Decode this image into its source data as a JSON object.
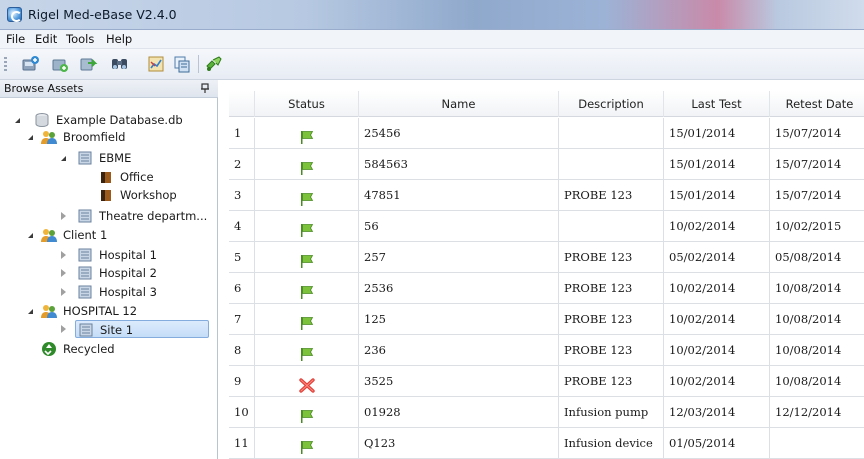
{
  "window": {
    "title": "Rigel Med-eBase V2.4.0"
  },
  "menu": [
    "File",
    "Edit",
    "Tools",
    "Help"
  ],
  "toolbar": {
    "buttons": [
      "add-asset-icon",
      "add-site-icon",
      "export-icon",
      "find-icon",
      "chart-icon",
      "copy-icon",
      "sync-icon"
    ]
  },
  "browse_panel": {
    "title": "Browse Assets"
  },
  "tree": {
    "database": "Example Database.db",
    "broomfield": "Broomfield",
    "ebme": "EBME",
    "office": "Office",
    "workshop": "Workshop",
    "theatre": "Theatre departm...",
    "client1": "Client 1",
    "hospital1": "Hospital 1",
    "hospital2": "Hospital 2",
    "hospital3": "Hospital 3",
    "hospital12": "HOSPITAL 12",
    "site1": "Site 1",
    "recycled": "Recycled"
  },
  "grid": {
    "columns": [
      "",
      "Status",
      "Name",
      "Description",
      "Last Test",
      "Retest Date"
    ],
    "rows": [
      {
        "num": "1",
        "status": "pass",
        "name": "25456",
        "description": "",
        "last_test": "15/01/2014",
        "retest": "15/07/2014"
      },
      {
        "num": "2",
        "status": "pass",
        "name": "584563",
        "description": "",
        "last_test": "15/01/2014",
        "retest": "15/07/2014"
      },
      {
        "num": "3",
        "status": "pass",
        "name": "47851",
        "description": "PROBE 123",
        "last_test": "15/01/2014",
        "retest": "15/07/2014"
      },
      {
        "num": "4",
        "status": "pass",
        "name": "56",
        "description": "",
        "last_test": "10/02/2014",
        "retest": "10/02/2015"
      },
      {
        "num": "5",
        "status": "pass",
        "name": "257",
        "description": "PROBE 123",
        "last_test": "05/02/2014",
        "retest": "05/08/2014"
      },
      {
        "num": "6",
        "status": "pass",
        "name": "2536",
        "description": "PROBE 123",
        "last_test": "10/02/2014",
        "retest": "10/08/2014"
      },
      {
        "num": "7",
        "status": "pass",
        "name": "125",
        "description": "PROBE 123",
        "last_test": "10/02/2014",
        "retest": "10/08/2014"
      },
      {
        "num": "8",
        "status": "pass",
        "name": "236",
        "description": "PROBE 123",
        "last_test": "10/02/2014",
        "retest": "10/08/2014"
      },
      {
        "num": "9",
        "status": "fail",
        "name": "3525",
        "description": "PROBE 123",
        "last_test": "10/02/2014",
        "retest": "10/08/2014"
      },
      {
        "num": "10",
        "status": "pass",
        "name": "01928",
        "description": "Infusion pump",
        "last_test": "12/03/2014",
        "retest": "12/12/2014"
      },
      {
        "num": "11",
        "status": "pass",
        "name": "Q123",
        "description": "Infusion device",
        "last_test": "01/05/2014",
        "retest": ""
      }
    ]
  },
  "colors": {
    "pass_flag": "#7cc23a",
    "fail_cross": "#e0413a",
    "selection": "#c5ddf8"
  }
}
